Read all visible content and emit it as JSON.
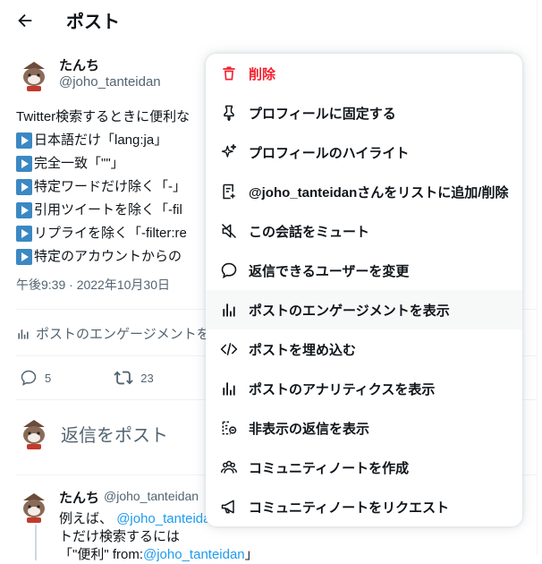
{
  "header": {
    "title": "ポスト"
  },
  "post": {
    "author_name": "たんち",
    "author_handle": "@joho_tanteidan",
    "lines": [
      "Twitter検索するときに便利な",
      "日本語だけ「lang:ja」",
      "完全一致「\"\"」",
      "特定ワードだけ除く「-」",
      "引用ツイートを除く「-fil",
      "リプライを除く「-filter:re",
      "特定のアカウントからの"
    ],
    "timestamp": "午後9:39 · 2022年10月30日",
    "engagement_link": "ポストのエンゲージメントを",
    "reply_count": "5",
    "repost_count": "23"
  },
  "compose": {
    "placeholder": "返信をポスト"
  },
  "reply": {
    "author_name": "たんち",
    "author_handle": "@joho_tanteidan",
    "line1_prefix": "例えば、",
    "line1_mention": "@joho_tanteida",
    "line2": "トだけ検索するには",
    "line3_prefix": "「\"便利\" from:",
    "line3_mention": "@joho_tanteidan",
    "line3_suffix": "」"
  },
  "menu": {
    "items": [
      {
        "label": "削除",
        "icon": "trash-icon",
        "danger": true
      },
      {
        "label": "プロフィールに固定する",
        "icon": "pin-icon"
      },
      {
        "label": "プロフィールのハイライト",
        "icon": "sparkle-icon"
      },
      {
        "label": "@joho_tanteidanさんをリストに追加/削除",
        "icon": "list-add-icon"
      },
      {
        "label": "この会話をミュート",
        "icon": "mute-icon"
      },
      {
        "label": "返信できるユーザーを変更",
        "icon": "chat-bubble-icon"
      },
      {
        "label": "ポストのエンゲージメントを表示",
        "icon": "bar-chart-icon",
        "hover": true
      },
      {
        "label": "ポストを埋め込む",
        "icon": "embed-code-icon"
      },
      {
        "label": "ポストのアナリティクスを表示",
        "icon": "analytics-icon"
      },
      {
        "label": "非表示の返信を表示",
        "icon": "hidden-replies-icon"
      },
      {
        "label": "コミュニティノートを作成",
        "icon": "people-icon"
      },
      {
        "label": "コミュニティノートをリクエスト",
        "icon": "megaphone-icon"
      }
    ]
  },
  "colors": {
    "danger": "#f4212e",
    "link": "#1d9bf0",
    "muted": "#536471",
    "hover": "#f7f9f9"
  }
}
